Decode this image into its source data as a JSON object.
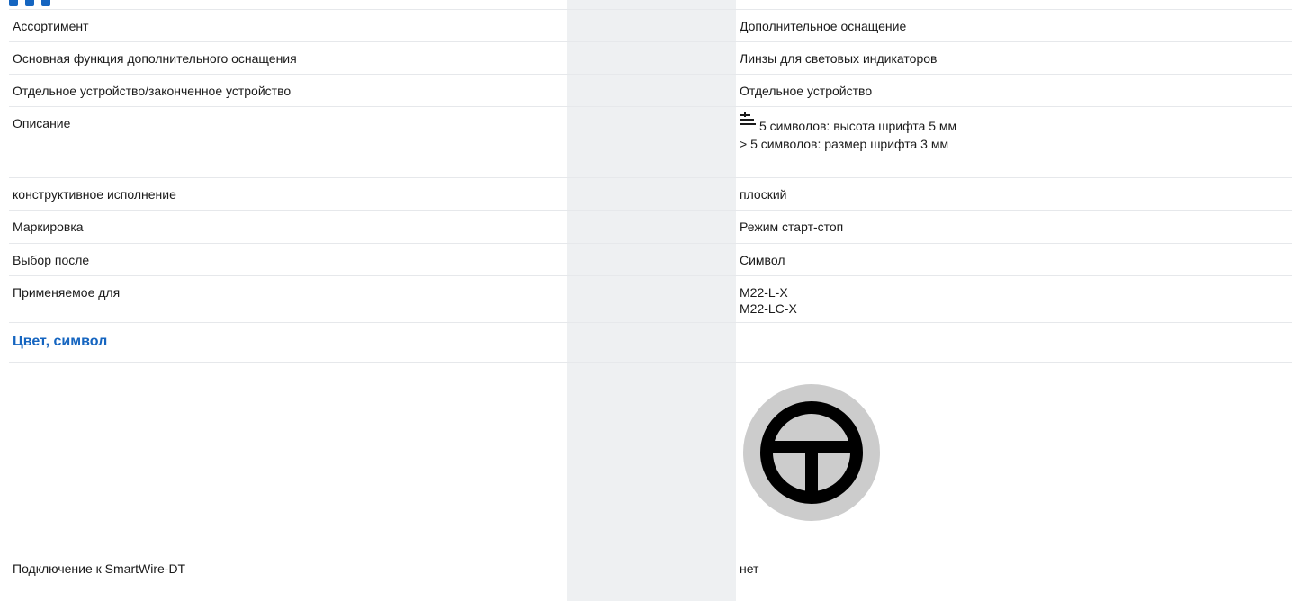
{
  "rows": [
    {
      "label": "Ассортимент",
      "value": "Дополнительное оснащение"
    },
    {
      "label": "Основная функция дополнительного оснащения",
      "value": "Линзы для световых индикаторов"
    },
    {
      "label": "Отдельное устройство/законченное устройство",
      "value": "Отдельное устройство"
    },
    {
      "label": "Описание",
      "value_line1": "5 символов: высота шрифта 5 мм",
      "value_line2": "> 5 символов: размер шрифта 3 мм",
      "icon": "text-lines-icon"
    },
    {
      "label": "конструктивное исполнение",
      "value": "плоский"
    },
    {
      "label": "Маркировка",
      "value": "Режим старт-стоп"
    },
    {
      "label": "Выбор после",
      "value": "Символ"
    },
    {
      "label": "Применяемое для",
      "value_line1": "M22-L-X",
      "value_line2": "M22-LC-X"
    }
  ],
  "section": {
    "title": "Цвет, символ",
    "symbol_icon": "start-stop-symbol-icon",
    "symbol_colors": {
      "disc": "#cccccc",
      "glyph": "#000000"
    }
  },
  "last_row": {
    "label": "Подключение к SmartWire-DT",
    "value": "нет"
  },
  "colors": {
    "accent": "#1565c0",
    "stripe": "#eef0f2"
  }
}
